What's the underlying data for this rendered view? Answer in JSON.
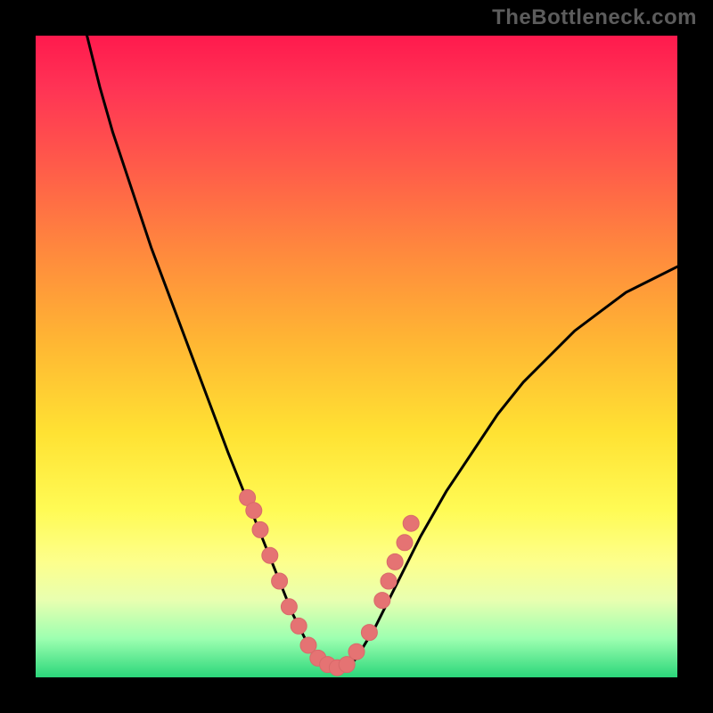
{
  "watermark": "TheBottleneck.com",
  "colors": {
    "background": "#000000",
    "curve": "#000000",
    "marker_fill": "#e57373",
    "marker_stroke": "#d86a6a",
    "gradient_top": "#ff1a4d",
    "gradient_bottom": "#2bd67a"
  },
  "chart_data": {
    "type": "line",
    "title": "",
    "xlabel": "",
    "ylabel": "",
    "xlim": [
      0,
      100
    ],
    "ylim": [
      0,
      100
    ],
    "grid": false,
    "curve": {
      "x": [
        8,
        10,
        12,
        15,
        18,
        21,
        24,
        27,
        30,
        32,
        34,
        36,
        38,
        40,
        42,
        44,
        46,
        48,
        50,
        53,
        56,
        60,
        64,
        68,
        72,
        76,
        80,
        84,
        88,
        92,
        96,
        100
      ],
      "y": [
        100,
        92,
        85,
        76,
        67,
        59,
        51,
        43,
        35,
        30,
        25,
        20,
        15,
        10,
        6,
        3,
        1,
        1,
        3,
        8,
        14,
        22,
        29,
        35,
        41,
        46,
        50,
        54,
        57,
        60,
        62,
        64
      ]
    },
    "markers": {
      "x": [
        33,
        34,
        35,
        36.5,
        38,
        39.5,
        41,
        42.5,
        44,
        45.5,
        47,
        48.5,
        50,
        52,
        54,
        55,
        56,
        57.5,
        58.5
      ],
      "y": [
        28,
        26,
        23,
        19,
        15,
        11,
        8,
        5,
        3,
        2,
        1.5,
        2,
        4,
        7,
        12,
        15,
        18,
        21,
        24
      ]
    }
  }
}
